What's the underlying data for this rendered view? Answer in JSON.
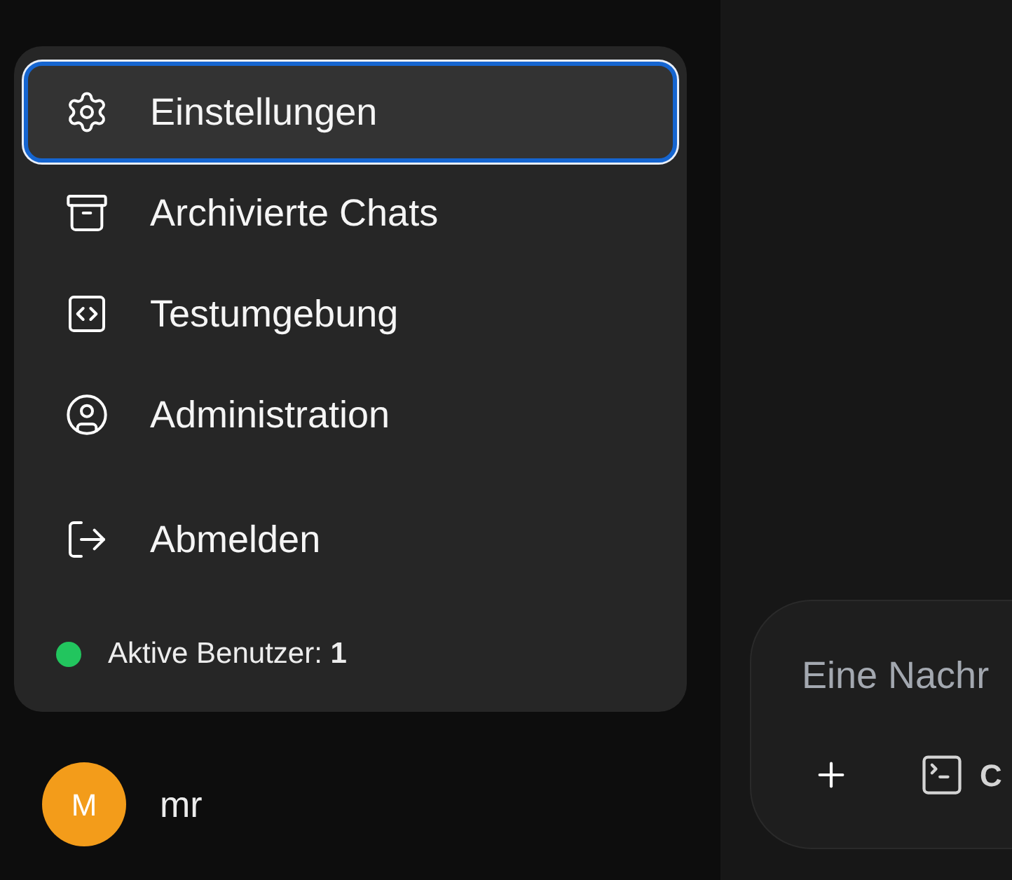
{
  "menu": {
    "items": [
      {
        "kind": "settings",
        "label": "Einstellungen",
        "selected": true
      },
      {
        "kind": "archive",
        "label": "Archivierte Chats",
        "selected": false
      },
      {
        "kind": "playground",
        "label": "Testumgebung",
        "selected": false
      },
      {
        "kind": "admin",
        "label": "Administration",
        "selected": false
      },
      {
        "kind": "logout",
        "label": "Abmelden",
        "selected": false
      }
    ],
    "status": {
      "label": "Aktive Benutzer:",
      "count": "1",
      "color": "#22c55e"
    }
  },
  "user": {
    "initial": "M",
    "name": "mr"
  },
  "composer": {
    "placeholder": "Eine Nachr",
    "buttons": [
      {
        "kind": "add"
      },
      {
        "kind": "terminal",
        "label": "C"
      }
    ]
  }
}
